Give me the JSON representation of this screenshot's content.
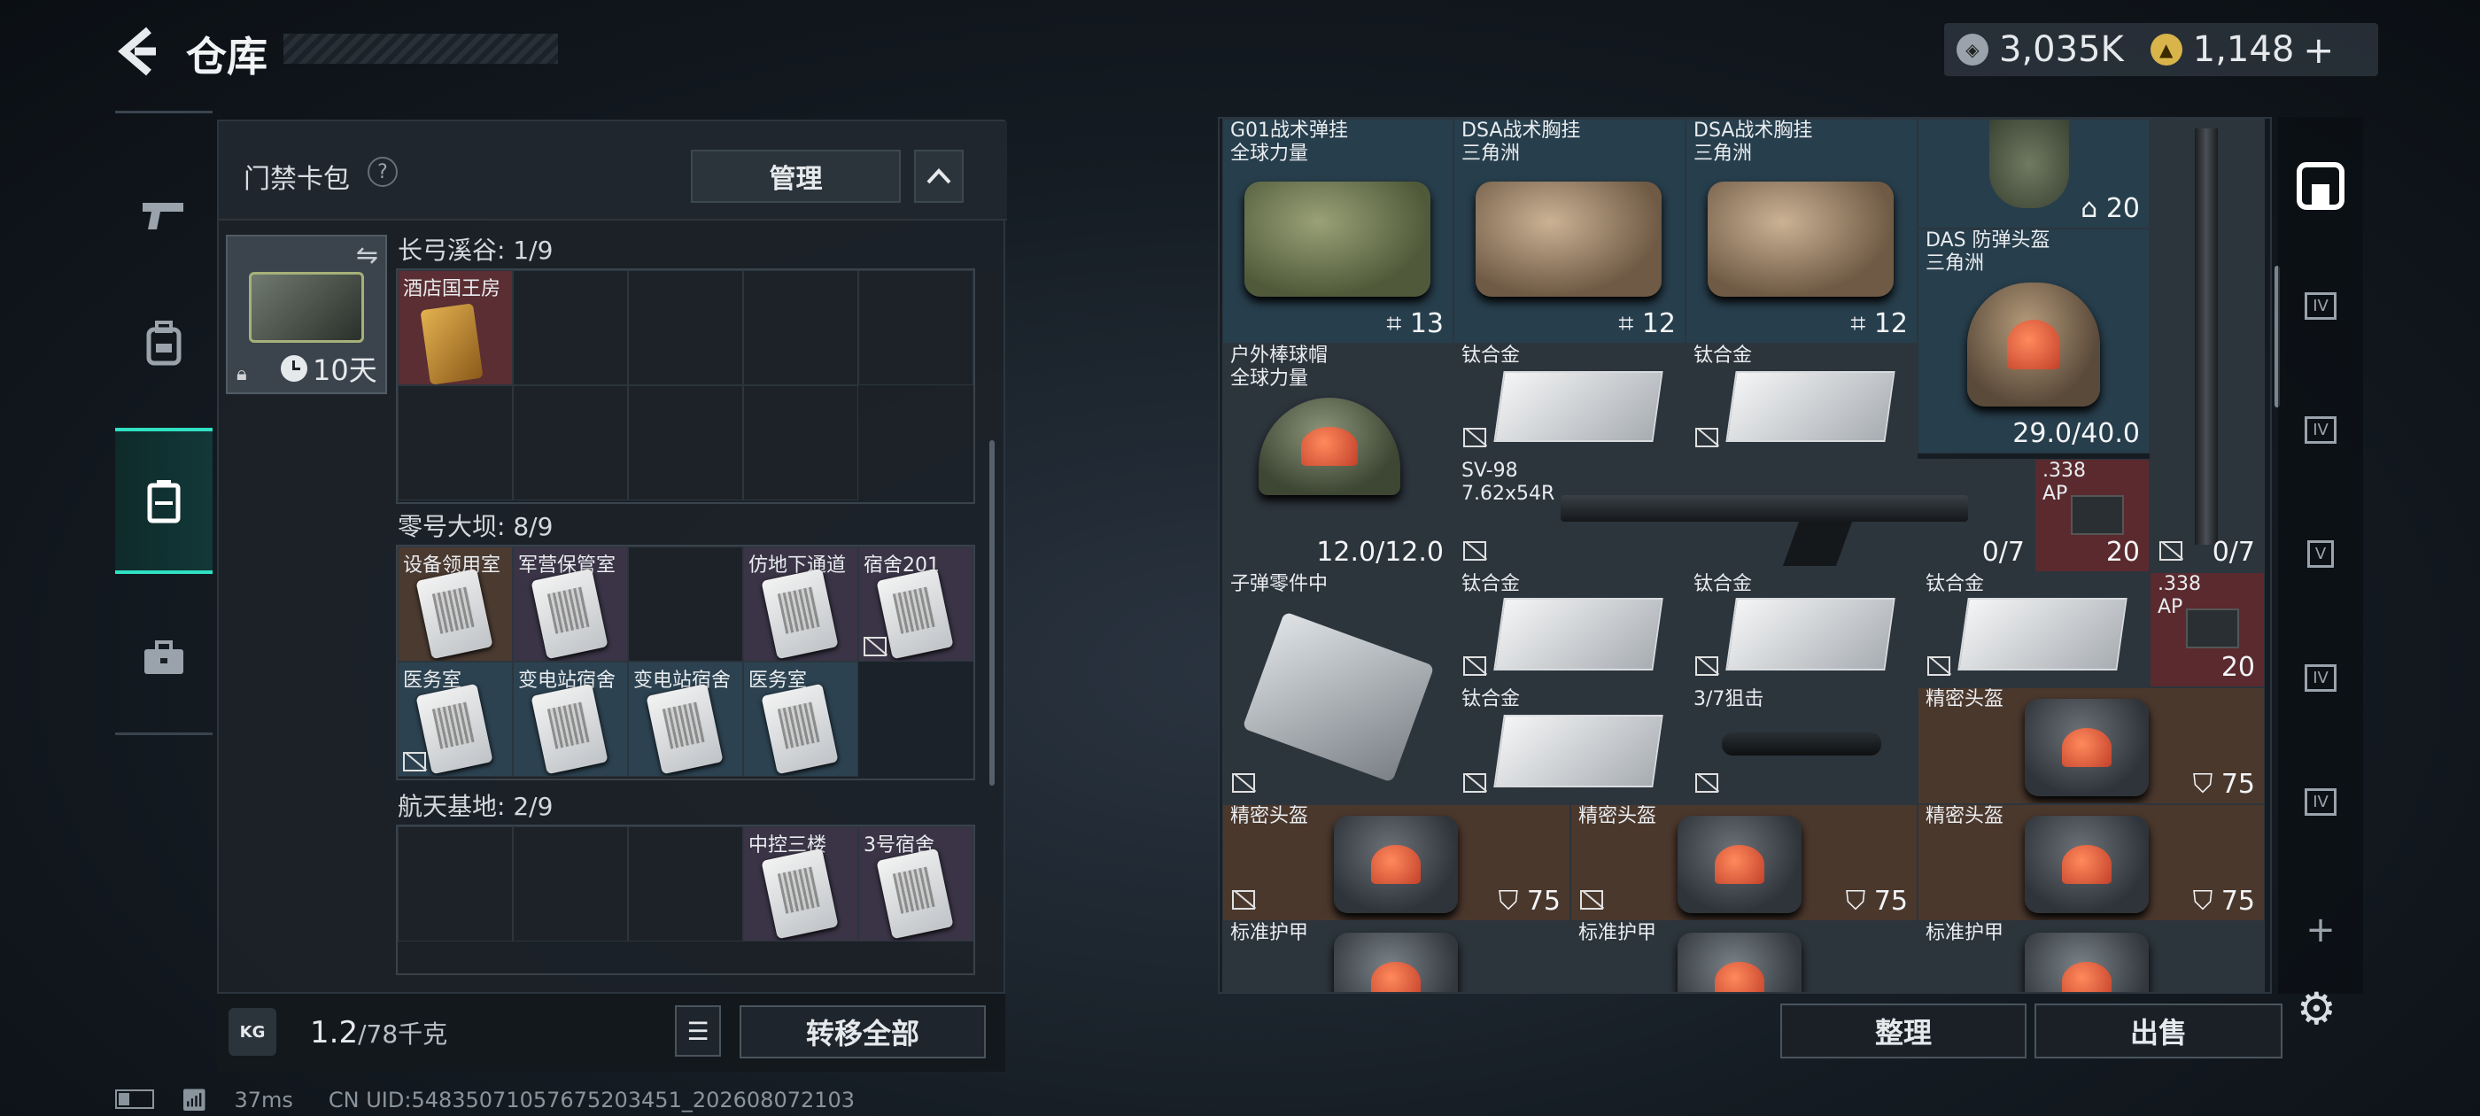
{
  "header": {
    "title": "仓库",
    "back_icon": "back-arrow-icon",
    "currency": {
      "silver": "3,035K",
      "gold": "1,148",
      "gold_add": "+"
    }
  },
  "left_nav": {
    "items": [
      "pistol-icon",
      "backpack-icon",
      "card-bag-icon",
      "toolbox-icon"
    ],
    "active_index": 2
  },
  "card_pack": {
    "title": "门禁卡包",
    "help": "?",
    "manage_label": "管理",
    "collapse_icon": "chevron-up-icon",
    "bag_timer": "10天",
    "swap_icon": "swap-icon",
    "sections": [
      {
        "title": "长弓溪谷: 1/9",
        "cells": [
          {
            "label": "酒店国王房",
            "color": "red"
          }
        ]
      },
      {
        "title": "零号大坝: 8/9",
        "cells": [
          {
            "label": "设备领用室",
            "color": "brown"
          },
          {
            "label": "军营保管室",
            "color": "purple"
          },
          {
            "label": "",
            "color": "empty"
          },
          {
            "label": "仿地下通道",
            "color": "purple"
          },
          {
            "label": "宿舍201",
            "color": "purple"
          },
          {
            "label": "医务室",
            "color": "blue"
          },
          {
            "label": "变电站宿舍",
            "color": "blue"
          },
          {
            "label": "变电站宿舍",
            "color": "blue"
          },
          {
            "label": "医务室",
            "color": "blue"
          }
        ]
      },
      {
        "title": "航天基地: 2/9",
        "cells": [
          {
            "label": "中控三楼",
            "color": "purple"
          },
          {
            "label": "3号宿舍",
            "color": "purple"
          }
        ]
      }
    ]
  },
  "weight": {
    "current": "1.2",
    "max": "/78千克",
    "kg_icon": "KG"
  },
  "transfer_all_label": "转移全部",
  "status_bar": {
    "ping": "37ms",
    "uid": "CN UID:5483507105767520345​1_202608072103"
  },
  "stash_items": [
    {
      "id": "i1",
      "name": "G01战术弹挂\n全球力量",
      "color": "blue",
      "count": "13"
    },
    {
      "id": "i2",
      "name": "DSA战术胸挂\n三角洲",
      "color": "blue",
      "count": "12"
    },
    {
      "id": "i3",
      "name": "DSA战术胸挂\n三角洲",
      "color": "blue",
      "count": "12"
    },
    {
      "id": "i4",
      "name": "",
      "color": "blue",
      "count": "20"
    },
    {
      "id": "i5",
      "name": "DAS 防弹头盔\n三角洲",
      "color": "blue",
      "count": "29.0/40.0"
    },
    {
      "id": "i6",
      "name": "户外棒球帽\n全球力量",
      "color": "gray",
      "count": "12.0/12.0"
    },
    {
      "id": "i7",
      "name": "钛合金",
      "color": "gray",
      "count": ""
    },
    {
      "id": "i8",
      "name": "钛合金",
      "color": "gray",
      "count": ""
    },
    {
      "id": "i9",
      "name": "SV-98\n7.62x54R",
      "color": "gray",
      "count": "0/7"
    },
    {
      "id": "i10",
      "name": ".338\nAP",
      "color": "red",
      "count": "20"
    },
    {
      "id": "i11",
      "name": "",
      "color": "gray",
      "count": "0/7"
    },
    {
      "id": "i12",
      "name": "子弹零件中",
      "color": "gray",
      "count": ""
    },
    {
      "id": "i13",
      "name": "钛合金",
      "color": "gray",
      "count": ""
    },
    {
      "id": "i14",
      "name": "钛合金",
      "color": "gray",
      "count": ""
    },
    {
      "id": "i15",
      "name": "钛合金",
      "color": "gray",
      "count": ""
    },
    {
      "id": "i16",
      "name": ".338\nAP",
      "color": "red",
      "count": "20"
    },
    {
      "id": "i17",
      "name": "钛合金",
      "color": "gray",
      "count": ""
    },
    {
      "id": "i18",
      "name": "3/7狙击",
      "color": "gray",
      "count": ""
    },
    {
      "id": "i19",
      "name": "精密头盔",
      "color": "brown",
      "count": "75"
    },
    {
      "id": "i20",
      "name": "精密头盔",
      "color": "brown",
      "count": "75"
    },
    {
      "id": "i21",
      "name": "精密头盔",
      "color": "brown",
      "count": "75"
    },
    {
      "id": "i22",
      "name": "精密头盔",
      "color": "brown",
      "count": "75"
    },
    {
      "id": "i23",
      "name": "标准护甲",
      "color": "gray",
      "count": ""
    },
    {
      "id": "i24",
      "name": "标准护甲",
      "color": "gray",
      "count": ""
    },
    {
      "id": "i25",
      "name": "标准护甲",
      "color": "gray",
      "count": ""
    }
  ],
  "right_nav": {
    "items": [
      "stash-home-icon",
      "case-icon",
      "case-icon",
      "case-icon",
      "case-icon",
      "case-icon",
      "add-icon"
    ],
    "case_level": "IV",
    "case_level_v": "V",
    "add": "+"
  },
  "sort_label": "整理",
  "sell_label": "出售"
}
